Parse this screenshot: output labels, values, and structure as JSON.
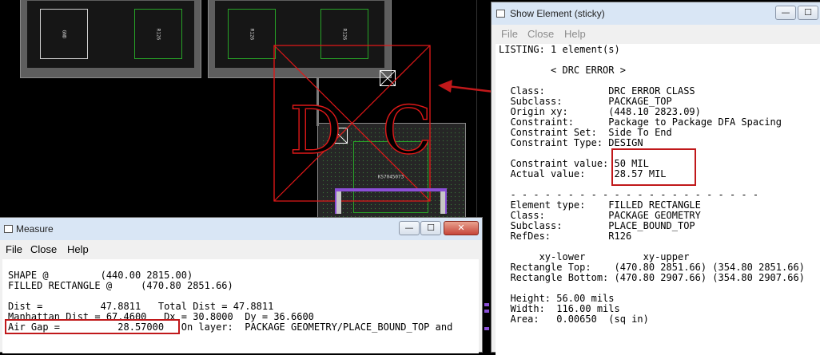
{
  "canvas": {
    "components": [
      {
        "ref": "gnd-part",
        "label": "GND"
      },
      {
        "ref": "left-green-part",
        "label": "R126"
      },
      {
        "ref": "mid-green-part",
        "label": "R126"
      },
      {
        "ref": "right-green-part",
        "label": "R126"
      },
      {
        "ref": "center-green-part",
        "label": "KS7045073"
      }
    ],
    "drc_marker": {
      "letters": [
        "D",
        "R",
        "C"
      ]
    },
    "colors": {
      "board": "#5e5e5e",
      "drc": "#e01818",
      "part_outline": "#27a327",
      "arrow": "#c0181a",
      "purple_trace": "#8a4fd6"
    }
  },
  "show_element": {
    "title": "Show Element (sticky)",
    "menu": [
      "File",
      "Close",
      "Help"
    ],
    "lines": [
      "LISTING: 1 element(s)",
      "",
      "         < DRC ERROR >",
      "",
      "  Class:           DRC ERROR CLASS",
      "  Subclass:        PACKAGE_TOP",
      "  Origin xy:       (448.10 2823.09)",
      "  Constraint:      Package to Package DFA Spacing",
      "  Constraint Set:  Side To End",
      "  Constraint Type: DESIGN",
      "",
      "  Constraint value: 50 MIL",
      "  Actual value:     28.57 MIL",
      "",
      "  - - - - - - - - - - - - - - - - - - - - - -",
      "  Element type:    FILLED RECTANGLE",
      "  Class:           PACKAGE GEOMETRY",
      "  Subclass:        PLACE_BOUND_TOP",
      "  RefDes:          R126",
      "",
      "       xy-lower          xy-upper",
      "  Rectangle Top:    (470.80 2851.66) (354.80 2851.66)",
      "  Rectangle Bottom: (470.80 2907.66) (354.80 2907.66)",
      "",
      "  Height: 56.00 mils",
      "  Width:  116.00 mils",
      "  Area:   0.00650  (sq in)"
    ]
  },
  "measure": {
    "title": "Measure",
    "menu": [
      "File",
      "Close",
      "Help"
    ],
    "lines": [
      "SHAPE @         (440.00 2815.00)",
      "FILLED RECTANGLE @     (470.80 2851.66)",
      "",
      "Dist =          47.8811   Total Dist = 47.8811",
      "Manhattan Dist = 67.4600   Dx = 30.8000  Dy = 36.6600",
      "Air Gap =          28.57000   On layer:  PACKAGE GEOMETRY/PLACE_BOUND_TOP and"
    ]
  },
  "window_buttons": {
    "minimize": "—",
    "maximize": "☐",
    "close": "✕"
  }
}
